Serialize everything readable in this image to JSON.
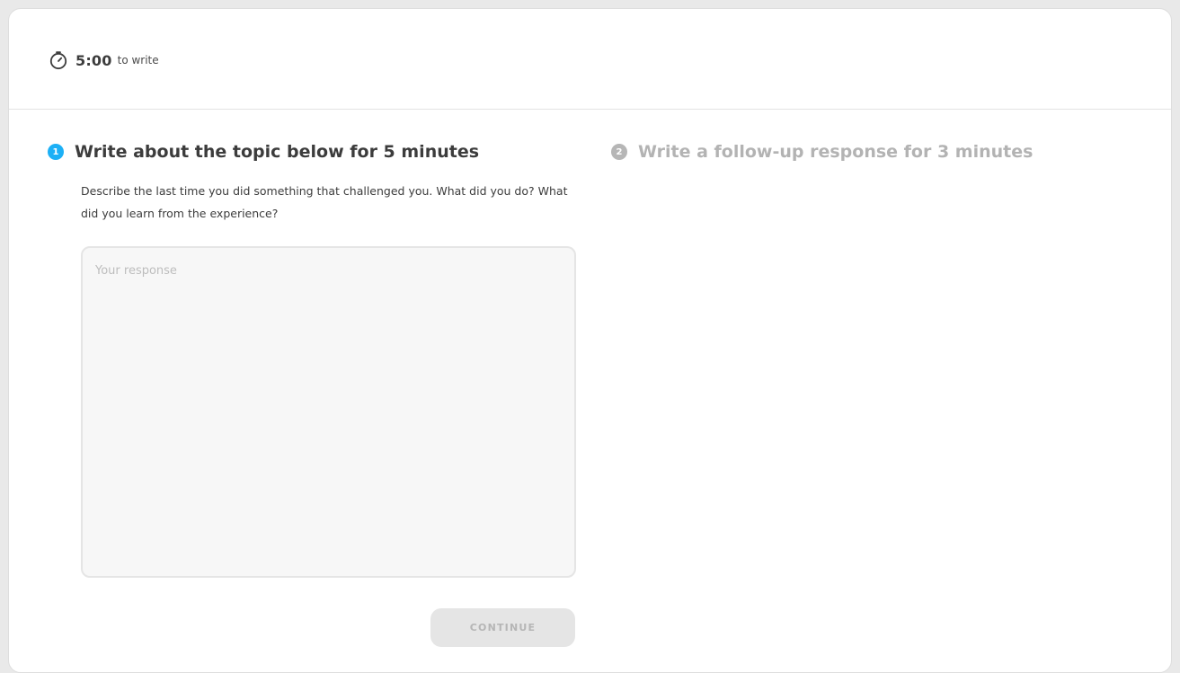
{
  "timer": {
    "value": "5:00",
    "suffix": "to write",
    "icon": "stopwatch-icon"
  },
  "step1": {
    "number": "1",
    "title": "Write about the topic below for 5 minutes",
    "prompt": "Describe the last time you did something that challenged you. What did you do? What did you learn from the experience?",
    "response_value": "",
    "response_placeholder": "Your response",
    "continue_label": "CONTINUE"
  },
  "step2": {
    "number": "2",
    "title": "Write a follow-up response for 3 minutes"
  },
  "colors": {
    "accent": "#1cb0f6",
    "muted": "#b6b6b6",
    "text": "#3c3c3c"
  }
}
